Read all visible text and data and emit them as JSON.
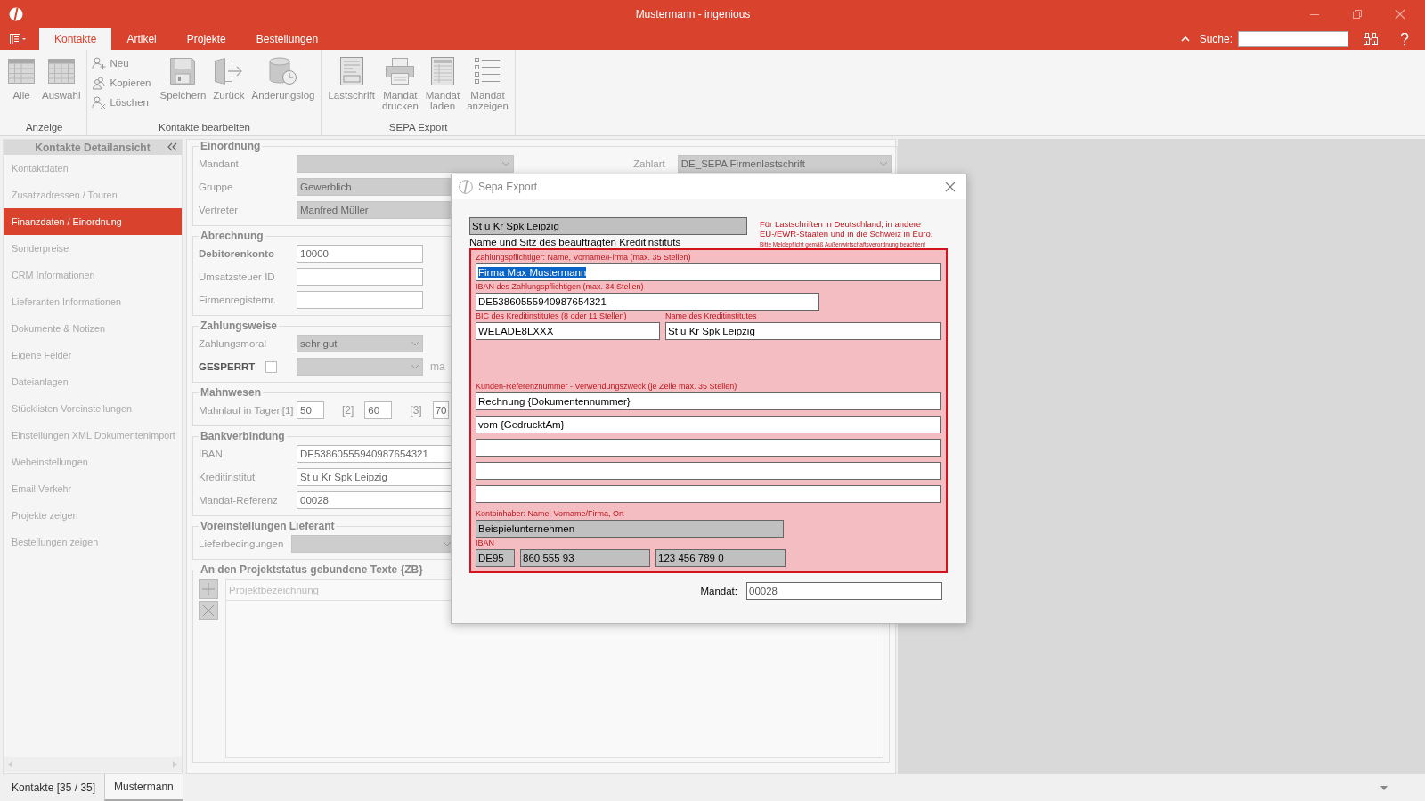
{
  "window": {
    "title": "Mustermann - ingenious"
  },
  "menu_tabs": [
    {
      "label": "Kontakte",
      "selected": true
    },
    {
      "label": "Artikel",
      "selected": false
    },
    {
      "label": "Projekte",
      "selected": false
    },
    {
      "label": "Bestellungen",
      "selected": false
    }
  ],
  "search": {
    "label": "Suche:"
  },
  "ribbon": {
    "groups": [
      {
        "title": "Anzeige",
        "buttons": [
          {
            "label": "Alle",
            "kind": "large"
          },
          {
            "label": "Auswahl",
            "kind": "large"
          }
        ]
      },
      {
        "title": "Kontakte bearbeiten",
        "buttons": [
          {
            "label": "Neu",
            "kind": "small"
          },
          {
            "label": "Kopieren",
            "kind": "small"
          },
          {
            "label": "Löschen",
            "kind": "small"
          },
          {
            "label": "Speichern",
            "kind": "large"
          },
          {
            "label": "Zurück",
            "kind": "large"
          },
          {
            "label": "Änderungslog",
            "kind": "large"
          }
        ]
      },
      {
        "title": "SEPA Export",
        "buttons": [
          {
            "label": "Lastschrift",
            "kind": "large"
          },
          {
            "label": "Mandat drucken",
            "kind": "large"
          },
          {
            "label": "Mandat laden",
            "kind": "large"
          },
          {
            "label": "Mandat anzeigen",
            "kind": "large"
          }
        ]
      }
    ]
  },
  "sidebar": {
    "title": "Kontakte Detailansicht",
    "items": [
      {
        "label": "Kontaktdaten",
        "selected": false
      },
      {
        "label": "Zusatzadressen / Touren",
        "selected": false
      },
      {
        "label": "Finanzdaten / Einordnung",
        "selected": true
      },
      {
        "label": "Sonderpreise",
        "selected": false
      },
      {
        "label": "CRM Informationen",
        "selected": false
      },
      {
        "label": "Lieferanten Informationen",
        "selected": false
      },
      {
        "label": "Dokumente & Notizen",
        "selected": false
      },
      {
        "label": "Eigene Felder",
        "selected": false
      },
      {
        "label": "Dateianlagen",
        "selected": false
      },
      {
        "label": "Stücklisten Voreinstellungen",
        "selected": false
      },
      {
        "label": "Einstellungen XML Dokumentenimport",
        "selected": false
      },
      {
        "label": "Webeinstellungen",
        "selected": false
      },
      {
        "label": "Email Verkehr",
        "selected": false
      },
      {
        "label": "Projekte zeigen",
        "selected": false
      },
      {
        "label": "Bestellungen zeigen",
        "selected": false
      }
    ]
  },
  "form": {
    "einordnung": {
      "title": "Einordnung",
      "mandant": {
        "label": "Mandant"
      },
      "zahlart": {
        "label": "Zahlart",
        "value": "DE_SEPA Firmenlastschrift"
      },
      "gruppe": {
        "label": "Gruppe",
        "value": "Gewerblich"
      },
      "vertreter": {
        "label": "Vertreter",
        "value": "Manfred Müller"
      }
    },
    "abrechnung": {
      "title": "Abrechnung",
      "debitorenkonto": {
        "label": "Debitorenkonto",
        "value": "10000"
      },
      "ust": {
        "label": "Umsatzsteuer ID"
      },
      "register": {
        "label": "Firmenregisternr."
      }
    },
    "zahlungsweise": {
      "title": "Zahlungsweise",
      "moral": {
        "label": "Zahlungsmoral",
        "value": "sehr gut"
      },
      "gesperrt": {
        "label": "GESPERRT",
        "checked": false
      },
      "column_3": "ma"
    },
    "mahnwesen": {
      "title": "Mahnwesen",
      "steps": [
        {
          "label": "Mahnlauf in Tagen[1]",
          "value": "50"
        },
        {
          "label": "[2]",
          "value": "60"
        },
        {
          "label": "[3]",
          "value": "70"
        }
      ]
    },
    "bank": {
      "title": "Bankverbindung",
      "iban": {
        "label": "IBAN",
        "value": "DE53860555940987654321"
      },
      "institut": {
        "label": "Kreditinstitut",
        "value": "St u Kr Spk Leipzig"
      },
      "mandat": {
        "label": "Mandat-Referenz",
        "value": "00028"
      }
    },
    "lieferant": {
      "title": "Voreinstellungen Lieferant",
      "bedingungen": {
        "label": "Lieferbedingungen"
      }
    },
    "projekttexte": {
      "title": "An den Projektstatus gebundene Texte {ZB}",
      "column": "Projektbezeichnung"
    }
  },
  "bottom_tabs": [
    {
      "label": "Kontakte [35 / 35]",
      "selected": false
    },
    {
      "label": "Mustermann",
      "selected": true
    }
  ],
  "sepa_dialog": {
    "title": "Sepa Export",
    "bank_name": "St u Kr Spk Leipzig",
    "bank_caption": "Name und Sitz des beauftragten Kreditinstituts",
    "notice": "Für Lastschriften in Deutschland, in andere EU-/EWR-Staaten und in die Schweiz in Euro.",
    "notice_small": "Bitte Meldepflicht gemäß Außenwirtschaftsverordnung beachten!",
    "payer": {
      "label": "Zahlungspflichtiger: Name, Vorname/Firma (max. 35 Stellen)",
      "value": "Firma Max Mustermann",
      "text_selected": true
    },
    "iban": {
      "label": "IBAN des Zahlungspflichtigen (max. 34 Stellen)",
      "value": "DE53860555940987654321"
    },
    "bic": {
      "label": "BIC des Kreditinstitutes (8 oder 11 Stellen)",
      "value": "WELADE8LXXX"
    },
    "bank": {
      "label": "Name des Kreditinstitutes",
      "value": "St u Kr Spk Leipzig"
    },
    "reference": {
      "label": "Kunden-Referenznummer - Verwendungszweck (je Zeile max. 35 Stellen)",
      "lines": [
        {
          "kind": "text",
          "value": "Rechnung {Dokumentennummer}"
        },
        {
          "kind": "text",
          "value": "vom {GedrucktAm}"
        },
        {
          "kind": "blank"
        },
        {
          "kind": "blank"
        },
        {
          "kind": "blank"
        }
      ]
    },
    "holder": {
      "label": "Kontoinhaber: Name, Vorname/Firma, Ort",
      "value": "Beispielunternehmen"
    },
    "holder_iban": {
      "label": "IBAN",
      "parts": [
        "DE95",
        "860 555 93",
        "123 456 789 0"
      ]
    },
    "mandate": {
      "label": "Mandat:",
      "value": "00028"
    }
  }
}
